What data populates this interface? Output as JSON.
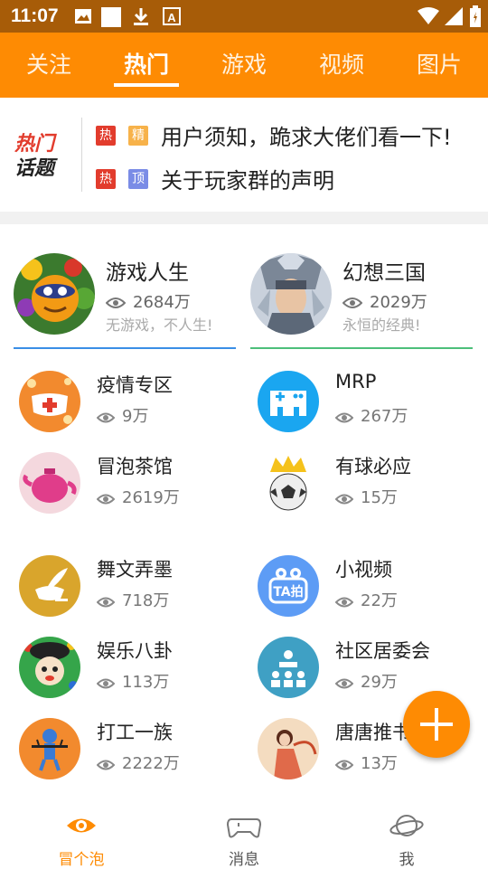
{
  "status_bar": {
    "time": "11:07"
  },
  "tabs": [
    {
      "label": "关注"
    },
    {
      "label": "热门"
    },
    {
      "label": "游戏"
    },
    {
      "label": "视频"
    },
    {
      "label": "图片"
    }
  ],
  "active_tab": "热门",
  "hot_topics": {
    "logo_line1": "热门",
    "logo_line2": "话题",
    "items": [
      {
        "badges": [
          "热",
          "精"
        ],
        "title": "用户须知，跪求大佬们看一下!"
      },
      {
        "badges": [
          "热",
          "顶"
        ],
        "title": "关于玩家群的声明"
      }
    ]
  },
  "featured": [
    {
      "name": "游戏人生",
      "views": "2684万",
      "tagline": "无游戏，不人生!"
    },
    {
      "name": "幻想三国",
      "views": "2029万",
      "tagline": "永恒的经典!"
    }
  ],
  "categories": [
    {
      "name": "疫情专区",
      "views": "9万"
    },
    {
      "name": "MRP",
      "views": "267万"
    },
    {
      "name": "冒泡茶馆",
      "views": "2619万"
    },
    {
      "name": "有球必应",
      "views": "15万"
    },
    {
      "name": "舞文弄墨",
      "views": "718万"
    },
    {
      "name": "小视频",
      "views": "22万"
    },
    {
      "name": "娱乐八卦",
      "views": "113万"
    },
    {
      "name": "社区居委会",
      "views": "29万"
    },
    {
      "name": "打工一族",
      "views": "2222万"
    },
    {
      "name": "唐唐推书",
      "views": "13万"
    }
  ],
  "video_icon_text": "TA拍",
  "bottom_nav": [
    {
      "label": "冒个泡",
      "icon": "eye-icon"
    },
    {
      "label": "消息",
      "icon": "gamepad-icon"
    },
    {
      "label": "我",
      "icon": "planet-icon"
    }
  ],
  "colors": {
    "accent": "#fe8b03",
    "status_bar": "#a75c08",
    "hot_badge": "#e23c2d",
    "jing_badge": "#f7b24a",
    "ding_badge": "#7a8ce6",
    "feat1_line": "#3a8ee6",
    "feat2_line": "#4cbf7a"
  }
}
